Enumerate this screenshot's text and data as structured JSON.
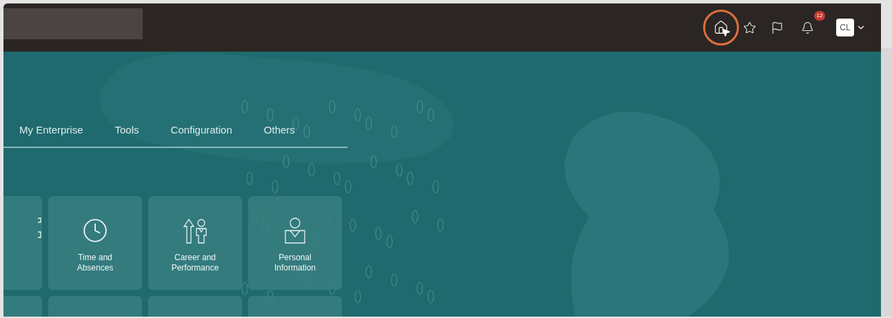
{
  "header": {
    "notifications": {
      "count": "12"
    },
    "avatar": {
      "initials": "CL"
    }
  },
  "nav_tabs": [
    {
      "label": "My Enterprise"
    },
    {
      "label": "Tools"
    },
    {
      "label": "Configuration"
    },
    {
      "label": "Others"
    }
  ],
  "tiles": [
    {
      "kind": "partial"
    },
    {
      "kind": "clock",
      "label": "Time and Absences"
    },
    {
      "kind": "career",
      "label": "Career and Performance"
    },
    {
      "kind": "person",
      "label": "Personal Information"
    }
  ]
}
